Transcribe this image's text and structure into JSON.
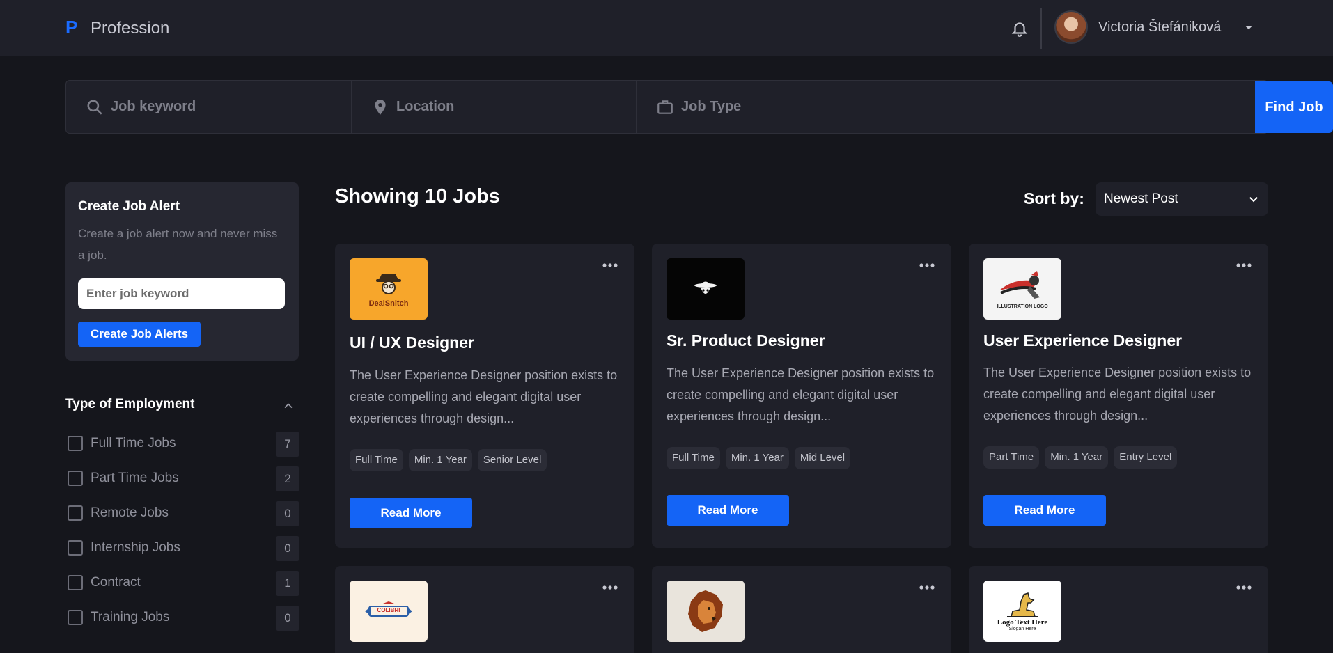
{
  "nav": {
    "logo_mark": "P",
    "brand": "Profession",
    "user_name": "Victoria Štefániková"
  },
  "search": {
    "keyword_placeholder": "Job keyword",
    "location_placeholder": "Location",
    "type_placeholder": "Job Type",
    "button": "Find Job"
  },
  "alert": {
    "title": "Create Job Alert",
    "text": "Create a job alert now and never miss a job.",
    "input_placeholder": "Enter job keyword",
    "button": "Create Job Alerts"
  },
  "filters": {
    "title": "Type of Employment",
    "items": [
      {
        "label": "Full Time Jobs",
        "count": "7"
      },
      {
        "label": "Part Time Jobs",
        "count": "2"
      },
      {
        "label": "Remote Jobs",
        "count": "0"
      },
      {
        "label": "Internship Jobs",
        "count": "0"
      },
      {
        "label": "Contract",
        "count": "1"
      },
      {
        "label": "Training Jobs",
        "count": "0"
      }
    ]
  },
  "listing": {
    "showing": "Showing 10 Jobs",
    "sort_label": "Sort by:",
    "sort_value": "Newest Post"
  },
  "colors": {
    "accent": "#1464f6",
    "background": "#15161c",
    "panel": "#1f2029"
  },
  "jobs": [
    {
      "logo": "DealSnitch",
      "title": "UI / UX Designer",
      "description": "The User Experience Designer position exists to create compelling and elegant digital user experiences through design...",
      "tags": [
        "Full Time",
        "Min. 1 Year",
        "Senior Level"
      ],
      "button": "Read More"
    },
    {
      "logo": "hat-man-icon",
      "title": "Sr. Product Designer",
      "description": "The User Experience Designer position exists to create compelling and elegant digital user experiences through design...",
      "tags": [
        "Full Time",
        "Min. 1 Year",
        "Mid Level"
      ],
      "button": "Read More"
    },
    {
      "logo": "ILLUSTRATION LOGO",
      "title": "User Experience Designer",
      "description": "The User Experience Designer position exists to create compelling and elegant digital user experiences through design...",
      "tags": [
        "Part Time",
        "Min. 1 Year",
        "Entry Level"
      ],
      "button": "Read More"
    }
  ],
  "jobs_row2": [
    {
      "logo": "COLIBRI"
    },
    {
      "logo": "lion-icon"
    },
    {
      "logo_title": "Logo Text Here",
      "logo_slogan": "Slogan Here"
    }
  ]
}
